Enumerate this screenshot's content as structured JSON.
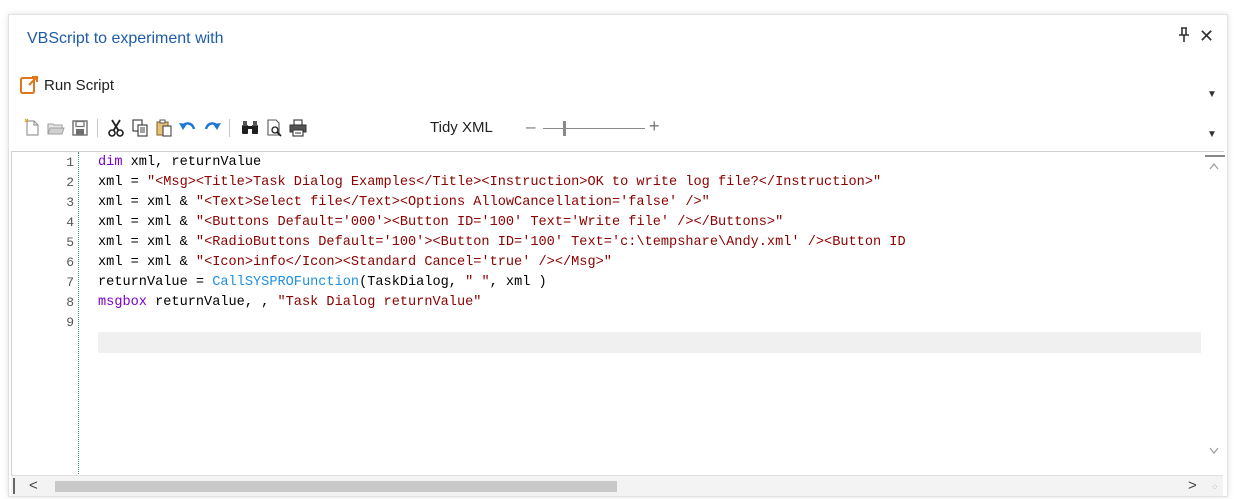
{
  "pane": {
    "title": "VBScript to experiment with",
    "pin_glyph": "⊥",
    "close_glyph": "✕"
  },
  "ribbon": {
    "run_script_label": "Run Script",
    "dropdown_glyph": "▼"
  },
  "toolbar": {
    "tidy_xml_label": "Tidy XML",
    "zoom_minus": "–",
    "zoom_plus": "+",
    "dropdown_glyph": "▼"
  },
  "editor": {
    "line_numbers": [
      "1",
      "2",
      "3",
      "4",
      "5",
      "6",
      "7",
      "8",
      "9"
    ],
    "lines": [
      [
        {
          "t": "kw",
          "v": "dim"
        },
        {
          "t": "plain",
          "v": " xml, returnValue"
        }
      ],
      [
        {
          "t": "plain",
          "v": "xml = "
        },
        {
          "t": "str",
          "v": "\"<Msg><Title>Task Dialog Examples</Title><Instruction>OK to write log file?</Instruction>\""
        }
      ],
      [
        {
          "t": "plain",
          "v": "xml = xml & "
        },
        {
          "t": "str",
          "v": "\"<Text>Select file</Text><Options AllowCancellation='false' />\""
        }
      ],
      [
        {
          "t": "plain",
          "v": "xml = xml & "
        },
        {
          "t": "str",
          "v": "\"<Buttons Default='000'><Button ID='100' Text='Write file' /></Buttons>\""
        }
      ],
      [
        {
          "t": "plain",
          "v": "xml = xml & "
        },
        {
          "t": "str",
          "v": "\"<RadioButtons Default='100'><Button ID='100' Text='c:\\tempshare\\Andy.xml' /><Button ID"
        }
      ],
      [
        {
          "t": "plain",
          "v": "xml = xml & "
        },
        {
          "t": "str",
          "v": "\"<Icon>info</Icon><Standard Cancel='true' /></Msg>\""
        }
      ],
      [
        {
          "t": "plain",
          "v": "returnValue = "
        },
        {
          "t": "fn",
          "v": "CallSYSPROFunction"
        },
        {
          "t": "plain",
          "v": "(TaskDialog, "
        },
        {
          "t": "str",
          "v": "\" \""
        },
        {
          "t": "plain",
          "v": ", xml )"
        }
      ],
      [
        {
          "t": "kw",
          "v": "msgbox"
        },
        {
          "t": "plain",
          "v": " returnValue, , "
        },
        {
          "t": "str",
          "v": "\"Task Dialog returnValue\""
        }
      ],
      []
    ]
  },
  "scrollbars": {
    "left_glyph": "<",
    "right_glyph": ">",
    "up_glyph": "▲",
    "down_glyph": "▼"
  },
  "colors": {
    "title": "#1e5ca8",
    "keyword": "#7a00cc",
    "string": "#8b0000",
    "function": "#1e90e0"
  }
}
